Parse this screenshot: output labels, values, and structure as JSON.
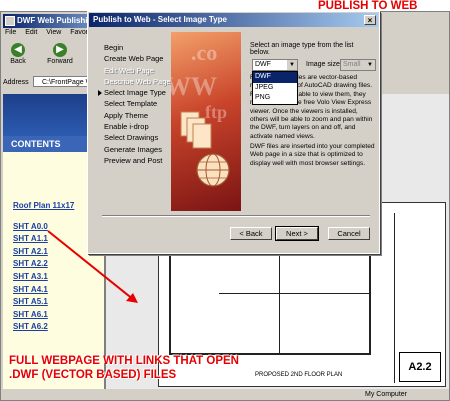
{
  "callouts": {
    "top": "PUBLISH TO WEB",
    "bottom_line1": "FULL WEBPAGE WITH LINKS THAT OPEN",
    "bottom_line2": ".DWF (VECTOR BASED) FILES"
  },
  "browser": {
    "title": "DWF Web Publishing - Micr",
    "menu": [
      "File",
      "Edit",
      "View",
      "Favorite"
    ],
    "toolbar": [
      "Back",
      "Forward",
      "St"
    ],
    "address_label": "Address",
    "address_value": "C:\\FrontPage Web\\",
    "contents_heading": "CONTENTS",
    "links": [
      "Roof Plan 11x17",
      "SHT A0.0",
      "SHT A1.1",
      "SHT A2.1",
      "SHT A2.2",
      "SHT A3.1",
      "SHT A4.1",
      "SHT A5.1",
      "SHT A6.1",
      "SHT A6.2"
    ],
    "drawing_stamp": "A2.2",
    "drawing_label": "PROPOSED 2ND FLOOR PLAN",
    "status_zone": "My Computer"
  },
  "dialog": {
    "title": "Publish to Web - Select Image Type",
    "close": "×",
    "steps": [
      {
        "label": "Begin",
        "state": "normal"
      },
      {
        "label": "Create Web Page",
        "state": "normal"
      },
      {
        "label": "Edit Web Page",
        "state": "disabled"
      },
      {
        "label": "Describe Web Page",
        "state": "disabled"
      },
      {
        "label": "Select Image Type",
        "state": "current"
      },
      {
        "label": "Select Template",
        "state": "normal"
      },
      {
        "label": "Apply Theme",
        "state": "normal"
      },
      {
        "label": "Enable i-drop",
        "state": "normal"
      },
      {
        "label": "Select Drawings",
        "state": "normal"
      },
      {
        "label": "Generate Images",
        "state": "normal"
      },
      {
        "label": "Preview and Post",
        "state": "normal"
      }
    ],
    "prompt": "Select an image type from the list below.",
    "image_type_value": "DWF",
    "image_type_options": [
      "DWF",
      "JPEG",
      "PNG"
    ],
    "image_size_label": "Image size:",
    "image_size_value": "Small",
    "paragraph1": "Format (DWF) files are vector-based representations of AutoCAD drawing files. For others to be able to view them, they need to install the free Volo View Express viewer. Once the viewers is installed, others will be able to zoom and pan within the DWF, turn layers on and off, and activate named views.",
    "paragraph2": "DWF files are inserted into your completed Web page in a size that is optimized to display well with most browser settings.",
    "buttons": {
      "back": "< Back",
      "next": "Next >",
      "cancel": "Cancel"
    }
  },
  "colors": {
    "callout": "#e60000",
    "titlebar": "#0a246a",
    "link": "#1a3ea6"
  }
}
